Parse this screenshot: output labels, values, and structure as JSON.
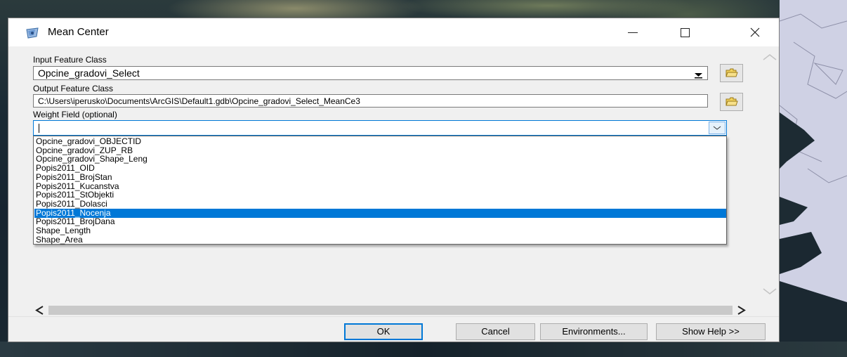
{
  "window": {
    "title": "Mean Center",
    "minimize_glyph": "—",
    "maximize_glyph": "☐",
    "close_glyph": "✕"
  },
  "form": {
    "input_feature_class": {
      "label": "Input Feature Class",
      "value": "Opcine_gradovi_Select"
    },
    "output_feature_class": {
      "label": "Output Feature Class",
      "value": "C:\\Users\\iperusko\\Documents\\ArcGIS\\Default1.gdb\\Opcine_gradovi_Select_MeanCe3"
    },
    "weight_field": {
      "label": "Weight Field (optional)",
      "value": "",
      "options": [
        "Opcine_gradovi_OBJECTID",
        "Opcine_gradovi_ZUP_RB",
        "Opcine_gradovi_Shape_Leng",
        "Popis2011_OID",
        "Popis2011_BrojStan",
        "Popis2011_Kucanstva",
        "Popis2011_StObjekti",
        "Popis2011_Dolasci",
        "Popis2011_Nocenja",
        "Popis2011_BrojDana",
        "Shape_Length",
        "Shape_Area"
      ],
      "highlighted": "Popis2011_Nocenja"
    }
  },
  "buttons": {
    "ok": "OK",
    "cancel": "Cancel",
    "environments": "Environments...",
    "show_help": "Show Help >>"
  },
  "scroll": {
    "left_glyph": "<",
    "right_glyph": ">"
  },
  "colors": {
    "accent": "#0078d7",
    "dialog_bg": "#f0f0f0"
  },
  "icons": {
    "app": "mean-center-tool-icon",
    "folder": "open-folder-icon"
  }
}
